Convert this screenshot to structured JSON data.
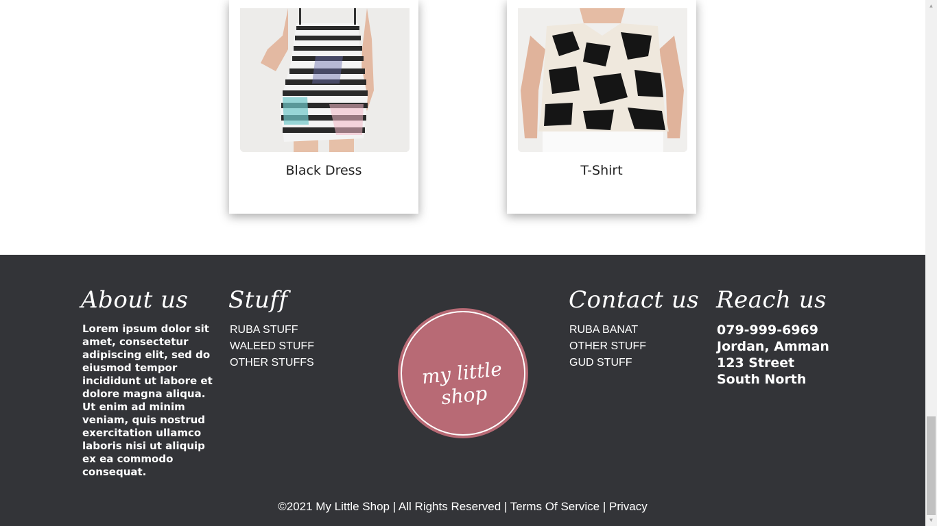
{
  "products": [
    {
      "name": "Black Dress",
      "image_icon": "dress-photo"
    },
    {
      "name": "T-Shirt",
      "image_icon": "top-photo"
    }
  ],
  "footer": {
    "about": {
      "title": "About us",
      "text": "Lorem ipsum dolor sit amet, consectetur adipiscing elit, sed do eiusmod tempor incididunt ut labore et dolore magna aliqua. Ut enim ad minim veniam, quis nostrud exercitation ullamco laboris nisi ut aliquip ex ea commodo consequat."
    },
    "stuff": {
      "title": "Stuff",
      "links": [
        "RUBA STUFF",
        "WALEED STUFF",
        "OTHER STUFFS"
      ]
    },
    "logo": {
      "text": "my little shop"
    },
    "contact": {
      "title": "Contact us",
      "links": [
        "RUBA BANAT",
        "OTHER STUFF",
        "GUD STUFF"
      ]
    },
    "reach": {
      "title": "Reach us",
      "phone": "079-999-6969",
      "city": "Jordan, Amman",
      "street": "123 Street South North"
    },
    "copyright": {
      "text": "©2021 My Little Shop | All Rights Reserved |",
      "terms": "Terms Of Service",
      "separator": "|",
      "privacy": "Privacy"
    }
  },
  "colors": {
    "footer_bg": "#333438",
    "logo_bg": "#b86a75"
  }
}
